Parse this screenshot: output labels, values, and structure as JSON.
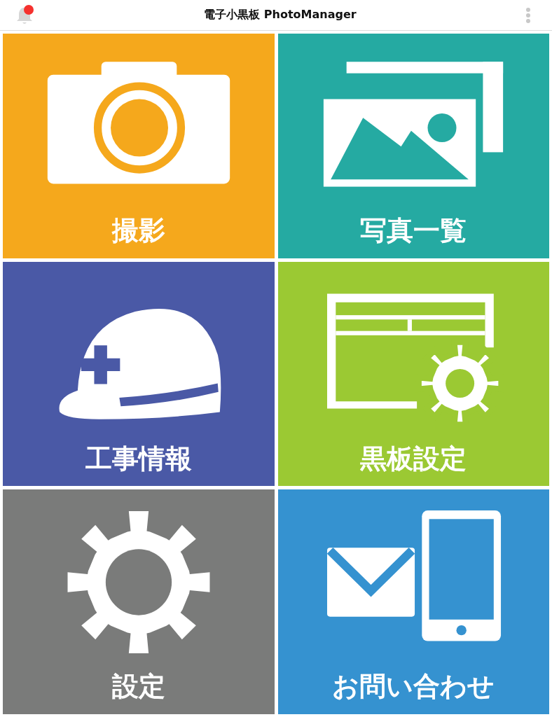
{
  "header": {
    "title": "電子小黒板 PhotoManager",
    "notification_unread": true
  },
  "tiles": [
    {
      "label": "撮影",
      "kind": "camera",
      "color": "#f5a81c"
    },
    {
      "label": "写真一覧",
      "kind": "photos",
      "color": "#25aaa2"
    },
    {
      "label": "工事情報",
      "kind": "helmet",
      "color": "#4a59a6"
    },
    {
      "label": "黒板設定",
      "kind": "board",
      "color": "#9bc933"
    },
    {
      "label": "設定",
      "kind": "gear",
      "color": "#7a7b7a"
    },
    {
      "label": "お問い合わせ",
      "kind": "contact",
      "color": "#3592d0"
    }
  ]
}
